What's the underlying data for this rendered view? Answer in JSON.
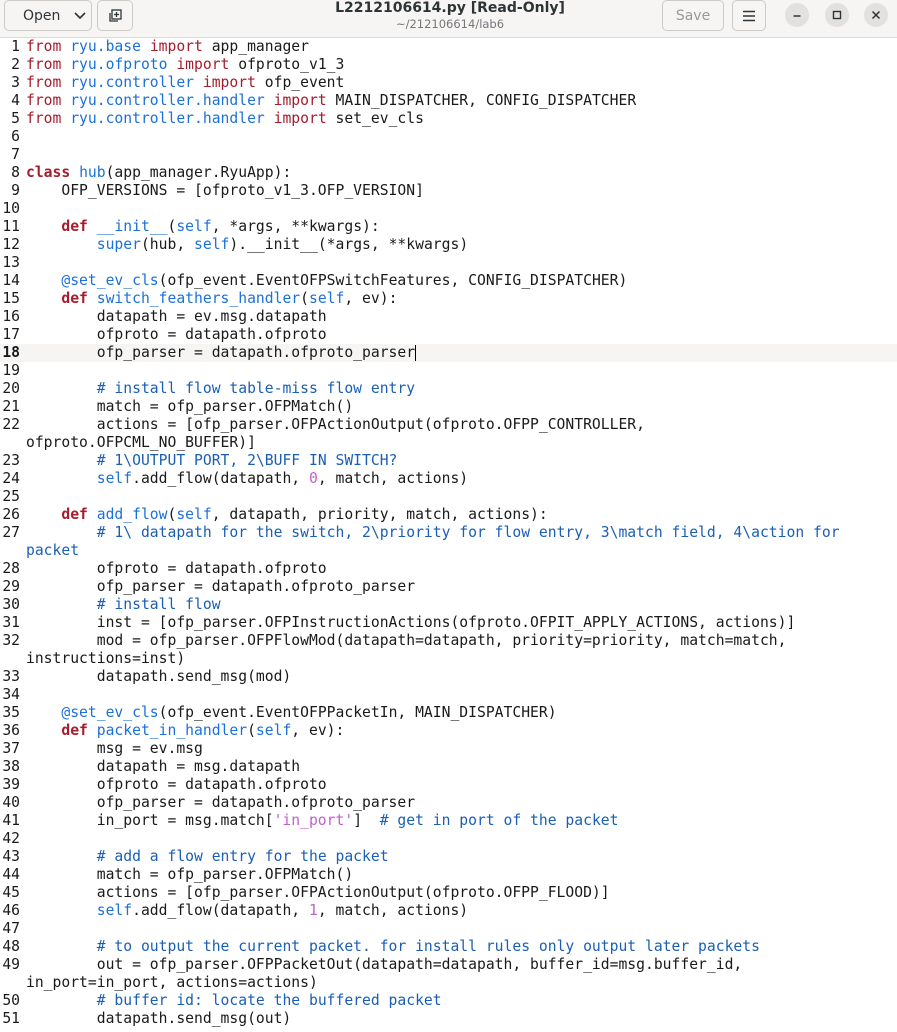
{
  "header": {
    "open_label": "Open",
    "title": "L2212106614.py [Read-Only]",
    "subtitle": "~/212106614/lab6",
    "save_label": "Save"
  },
  "editor": {
    "current_line": 18,
    "lines": [
      {
        "n": "1",
        "t": [
          [
            "from",
            "kw2"
          ],
          [
            " "
          ],
          [
            "ryu.base",
            "mod"
          ],
          [
            " "
          ],
          [
            "import",
            "kw2"
          ],
          [
            " app_manager"
          ]
        ]
      },
      {
        "n": "2",
        "t": [
          [
            "from",
            "kw2"
          ],
          [
            " "
          ],
          [
            "ryu.ofproto",
            "mod"
          ],
          [
            " "
          ],
          [
            "import",
            "kw2"
          ],
          [
            " ofproto_v1_3"
          ]
        ]
      },
      {
        "n": "3",
        "t": [
          [
            "from",
            "kw2"
          ],
          [
            " "
          ],
          [
            "ryu.controller",
            "mod"
          ],
          [
            " "
          ],
          [
            "import",
            "kw2"
          ],
          [
            " ofp_event"
          ]
        ]
      },
      {
        "n": "4",
        "t": [
          [
            "from",
            "kw2"
          ],
          [
            " "
          ],
          [
            "ryu.controller.handler",
            "mod"
          ],
          [
            " "
          ],
          [
            "import",
            "kw2"
          ],
          [
            " MAIN_DISPATCHER, CONFIG_DISPATCHER"
          ]
        ]
      },
      {
        "n": "5",
        "t": [
          [
            "from",
            "kw2"
          ],
          [
            " "
          ],
          [
            "ryu.controller.handler",
            "mod"
          ],
          [
            " "
          ],
          [
            "import",
            "kw2"
          ],
          [
            " set_ev_cls"
          ]
        ]
      },
      {
        "n": "6",
        "t": []
      },
      {
        "n": "7",
        "t": []
      },
      {
        "n": "8",
        "t": [
          [
            "class",
            "kw"
          ],
          [
            " "
          ],
          [
            "hub",
            "fn"
          ],
          [
            "(app_manager.RyuApp):"
          ]
        ]
      },
      {
        "n": "9",
        "t": [
          [
            "    OFP_VERSIONS = [ofproto_v1_3.OFP_VERSION]"
          ]
        ]
      },
      {
        "n": "10",
        "t": []
      },
      {
        "n": "11",
        "t": [
          [
            "    "
          ],
          [
            "def",
            "kw"
          ],
          [
            " "
          ],
          [
            "__init__",
            "fn"
          ],
          [
            "("
          ],
          [
            "self",
            "fn"
          ],
          [
            ", *args, **kwargs):"
          ]
        ]
      },
      {
        "n": "12",
        "t": [
          [
            "        "
          ],
          [
            "super",
            "fn"
          ],
          [
            "(hub, "
          ],
          [
            "self",
            "fn"
          ],
          [
            ").__init__(*args, **kwargs)"
          ]
        ]
      },
      {
        "n": "13",
        "t": []
      },
      {
        "n": "14",
        "t": [
          [
            "    "
          ],
          [
            "@set_ev_cls",
            "dec"
          ],
          [
            "(ofp_event.EventOFPSwitchFeatures, CONFIG_DISPATCHER)"
          ]
        ]
      },
      {
        "n": "15",
        "t": [
          [
            "    "
          ],
          [
            "def",
            "kw"
          ],
          [
            " "
          ],
          [
            "switch_feathers_handler",
            "fn"
          ],
          [
            "("
          ],
          [
            "self",
            "fn"
          ],
          [
            ", ev):"
          ]
        ]
      },
      {
        "n": "16",
        "t": [
          [
            "        datapath = ev.msg.datapath"
          ]
        ]
      },
      {
        "n": "17",
        "t": [
          [
            "        ofproto = datapath.ofproto"
          ]
        ]
      },
      {
        "n": "18",
        "t": [
          [
            "        ofp_parser = datapath.ofproto_parser"
          ]
        ],
        "cursor": true
      },
      {
        "n": "19",
        "t": []
      },
      {
        "n": "20",
        "t": [
          [
            "        "
          ],
          [
            "# install flow table-miss flow entry",
            "cm"
          ]
        ]
      },
      {
        "n": "21",
        "t": [
          [
            "        match = ofp_parser.OFPMatch()"
          ]
        ]
      },
      {
        "n": "22",
        "t": [
          [
            "        actions = [ofp_parser.OFPActionOutput(ofproto.OFPP_CONTROLLER,"
          ]
        ]
      },
      {
        "n": "",
        "t": [
          [
            "ofproto.OFPCML_NO_BUFFER)]"
          ]
        ]
      },
      {
        "n": "23",
        "t": [
          [
            "        "
          ],
          [
            "# 1\\OUTPUT PORT, 2\\BUFF IN SWITCH?",
            "cm"
          ]
        ]
      },
      {
        "n": "24",
        "t": [
          [
            "        "
          ],
          [
            "self",
            "fn"
          ],
          [
            ".add_flow(datapath, "
          ],
          [
            "0",
            "nu"
          ],
          [
            ", match, actions)"
          ]
        ]
      },
      {
        "n": "25",
        "t": []
      },
      {
        "n": "26",
        "t": [
          [
            "    "
          ],
          [
            "def",
            "kw"
          ],
          [
            " "
          ],
          [
            "add_flow",
            "fn"
          ],
          [
            "("
          ],
          [
            "self",
            "fn"
          ],
          [
            ", datapath, priority, match, actions):"
          ]
        ]
      },
      {
        "n": "27",
        "t": [
          [
            "        "
          ],
          [
            "# 1\\ datapath for the switch, 2\\priority for flow entry, 3\\match field, 4\\action for",
            "cm"
          ]
        ]
      },
      {
        "n": "",
        "t": [
          [
            "packet",
            "cm"
          ]
        ]
      },
      {
        "n": "28",
        "t": [
          [
            "        ofproto = datapath.ofproto"
          ]
        ]
      },
      {
        "n": "29",
        "t": [
          [
            "        ofp_parser = datapath.ofproto_parser"
          ]
        ]
      },
      {
        "n": "30",
        "t": [
          [
            "        "
          ],
          [
            "# install flow",
            "cm"
          ]
        ]
      },
      {
        "n": "31",
        "t": [
          [
            "        inst = [ofp_parser.OFPInstructionActions(ofproto.OFPIT_APPLY_ACTIONS, actions)]"
          ]
        ]
      },
      {
        "n": "32",
        "t": [
          [
            "        mod = ofp_parser.OFPFlowMod(datapath=datapath, priority=priority, match=match,"
          ]
        ]
      },
      {
        "n": "",
        "t": [
          [
            "instructions=inst)"
          ]
        ]
      },
      {
        "n": "33",
        "t": [
          [
            "        datapath.send_msg(mod)"
          ]
        ]
      },
      {
        "n": "34",
        "t": []
      },
      {
        "n": "35",
        "t": [
          [
            "    "
          ],
          [
            "@set_ev_cls",
            "dec"
          ],
          [
            "(ofp_event.EventOFPPacketIn, MAIN_DISPATCHER)"
          ]
        ]
      },
      {
        "n": "36",
        "t": [
          [
            "    "
          ],
          [
            "def",
            "kw"
          ],
          [
            " "
          ],
          [
            "packet_in_handler",
            "fn"
          ],
          [
            "("
          ],
          [
            "self",
            "fn"
          ],
          [
            ", ev):"
          ]
        ]
      },
      {
        "n": "37",
        "t": [
          [
            "        msg = ev.msg"
          ]
        ]
      },
      {
        "n": "38",
        "t": [
          [
            "        datapath = msg.datapath"
          ]
        ]
      },
      {
        "n": "39",
        "t": [
          [
            "        ofproto = datapath.ofproto"
          ]
        ]
      },
      {
        "n": "40",
        "t": [
          [
            "        ofp_parser = datapath.ofproto_parser"
          ]
        ]
      },
      {
        "n": "41",
        "t": [
          [
            "        in_port = msg.match["
          ],
          [
            "'in_port'",
            "st"
          ],
          [
            "]  "
          ],
          [
            "# get in port of the packet",
            "cm"
          ]
        ]
      },
      {
        "n": "42",
        "t": []
      },
      {
        "n": "43",
        "t": [
          [
            "        "
          ],
          [
            "# add a flow entry for the packet",
            "cm"
          ]
        ]
      },
      {
        "n": "44",
        "t": [
          [
            "        match = ofp_parser.OFPMatch()"
          ]
        ]
      },
      {
        "n": "45",
        "t": [
          [
            "        actions = [ofp_parser.OFPActionOutput(ofproto.OFPP_FLOOD)]"
          ]
        ]
      },
      {
        "n": "46",
        "t": [
          [
            "        "
          ],
          [
            "self",
            "fn"
          ],
          [
            ".add_flow(datapath, "
          ],
          [
            "1",
            "nu"
          ],
          [
            ", match, actions)"
          ]
        ]
      },
      {
        "n": "47",
        "t": []
      },
      {
        "n": "48",
        "t": [
          [
            "        "
          ],
          [
            "# to output the current packet. for install rules only output later packets",
            "cm"
          ]
        ]
      },
      {
        "n": "49",
        "t": [
          [
            "        out = ofp_parser.OFPPacketOut(datapath=datapath, buffer_id=msg.buffer_id,"
          ]
        ]
      },
      {
        "n": "",
        "t": [
          [
            "in_port=in_port, actions=actions)"
          ]
        ]
      },
      {
        "n": "50",
        "t": [
          [
            "        "
          ],
          [
            "# buffer id: locate the buffered packet",
            "cm"
          ]
        ]
      },
      {
        "n": "51",
        "t": [
          [
            "        datapath.send_msg(out)"
          ]
        ]
      }
    ]
  }
}
